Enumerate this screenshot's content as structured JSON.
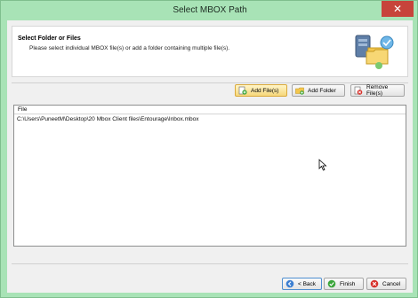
{
  "window": {
    "title": "Select MBOX Path",
    "close_glyph": "✕"
  },
  "header": {
    "title": "Select Folder or Files",
    "subtitle": "Please select individual MBOX file(s) or add a folder containing multiple file(s).",
    "icon": "folder-files-icon"
  },
  "toolbar": {
    "add_files_label": "Add File(s)",
    "add_folder_label": "Add Folder",
    "remove_files_label": "Remove File(s)"
  },
  "file_list": {
    "column_header": "File",
    "rows": [
      "C:\\Users\\PuneetM\\Desktop\\20 Mbox Client files\\Entourage\\Inbox.mbox"
    ]
  },
  "footer": {
    "back_label": "< Back",
    "finish_label": "Finish",
    "cancel_label": "Cancel"
  },
  "colors": {
    "window_frame": "#a8e3b6",
    "close_button": "#c7443b",
    "client_bg": "#f0f0f0",
    "add_files_highlight": "#f6d77a"
  }
}
